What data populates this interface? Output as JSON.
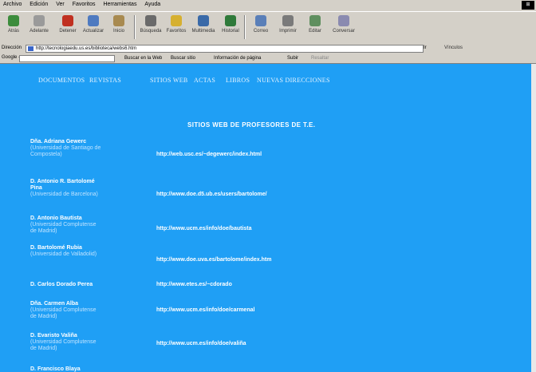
{
  "browser": {
    "menu": [
      "Archivo",
      "Edición",
      "Ver",
      "Favoritos",
      "Herramientas",
      "Ayuda"
    ],
    "toolbar": [
      {
        "label": "Atrás",
        "icon": "back-arrow-icon"
      },
      {
        "label": "Adelante",
        "icon": "forward-arrow-icon"
      },
      {
        "label": "Detener",
        "icon": "stop-icon"
      },
      {
        "label": "Actualizar",
        "icon": "refresh-icon"
      },
      {
        "label": "Inicio",
        "icon": "home-icon"
      },
      {
        "label": "Búsqueda",
        "icon": "search-icon"
      },
      {
        "label": "Favoritos",
        "icon": "favorites-icon"
      },
      {
        "label": "Multimedia",
        "icon": "media-icon"
      },
      {
        "label": "Historial",
        "icon": "history-icon"
      },
      {
        "label": "Correo",
        "icon": "mail-icon"
      },
      {
        "label": "Imprimir",
        "icon": "print-icon"
      },
      {
        "label": "Editar",
        "icon": "edit-icon"
      },
      {
        "label": "Conversar",
        "icon": "discuss-icon"
      }
    ],
    "address_label": "Dirección",
    "address": "http://tecnologiaedu.us.es/biblioteca/webs6.htm",
    "go_label": "Ir",
    "links_label": "Vínculos",
    "google": {
      "brand": "Google -",
      "items": [
        "Buscar en la Web",
        "Buscar sitio",
        "Información de página",
        "Subir",
        "Resaltar"
      ]
    }
  },
  "page": {
    "nav": [
      "DOCUMENTOS",
      "REVISTAS",
      "SITIOS WEB",
      "ACTAS",
      "LIBROS",
      "NUEVAS DIRECCIONES"
    ],
    "title": "SITIOS WEB DE PROFESORES DE T.E.",
    "entries": [
      {
        "name": "Dña. Adriana Gewerc",
        "affiliation": "(Universidad de Santiago de Compostela)",
        "url": "http://web.usc.es/~degewerc/index.html"
      },
      {
        "name": "D. Antonio R. Bartolomé Pina",
        "affiliation": "(Universidad de Barcelona)",
        "url": "http://www.doe.d5.ub.es/users/bartolome/"
      },
      {
        "name": "D. Antonio Bautista",
        "affiliation": "(Universidad Complutense de Madrid)",
        "url": "http://www.ucm.es/info/doe/bautista"
      },
      {
        "name": "D. Bartolomé Rubia",
        "affiliation": "(Universidad de Valladolid)",
        "url": "http://www.doe.uva.es/bartolome/index.htm"
      },
      {
        "name": "D. Carlos Dorado Perea",
        "affiliation": "",
        "url": "http://www.etes.es/~cdorado"
      },
      {
        "name": "Dña. Carmen Alba",
        "affiliation": "(Universidad Complutense de Madrid)",
        "url": "http://www.ucm.es/info/doe/carmenal"
      },
      {
        "name": "D. Evaristo Valiña",
        "affiliation": "(Universidad Complutense de Madrid)",
        "url": "http://www.ucm.es/info/doe/valiña"
      },
      {
        "name": "D. Francisco Blaya",
        "affiliation": "",
        "url": ""
      }
    ]
  },
  "colors": {
    "page_bg": "#1f9ff5",
    "chrome": "#d4d0c8"
  }
}
